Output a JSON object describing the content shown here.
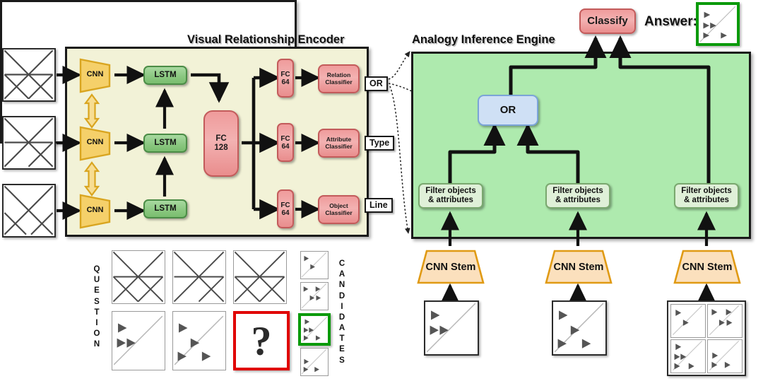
{
  "encoder": {
    "title": "Visual Relationship Encoder",
    "cnn_label": "CNN",
    "lstm_label": "LSTM",
    "fc128_label": "FC\n128",
    "fc128_line1": "FC",
    "fc128_line2": "128",
    "fc64_line1": "FC",
    "fc64_line2": "64",
    "classifiers": [
      {
        "line1": "Relation",
        "line2": "Classifier"
      },
      {
        "line1": "Attribute",
        "line2": "Classifier"
      },
      {
        "line1": "Object",
        "line2": "Classifier"
      }
    ],
    "branches": [
      {
        "fc": [
          "FC",
          "64"
        ],
        "classifier": [
          "Relation",
          "Classifier"
        ],
        "tag": "OR"
      },
      {
        "fc": [
          "FC",
          "64"
        ],
        "classifier": [
          "Attribute",
          "Classifier"
        ],
        "tag": "Type"
      },
      {
        "fc": [
          "FC",
          "64"
        ],
        "classifier": [
          "Object",
          "Classifier"
        ],
        "tag": "Line"
      }
    ],
    "input_rows": 3,
    "colors": {
      "panel_bg": "#f2f2d7",
      "cnn_fill": "#f5d06a",
      "cnn_stroke": "#d9a520",
      "lstm_fill": "#8cc882",
      "fc_fill": "#ef9b9b"
    }
  },
  "tags": {
    "or": "OR",
    "type": "Type",
    "line": "Line"
  },
  "engine": {
    "title": "Analogy Inference Engine",
    "or_node": "OR",
    "filter_line1": "Filter objects",
    "filter_line2": "& attributes",
    "filters": [
      {
        "line1": "Filter objects",
        "line2": "& attributes"
      },
      {
        "line1": "Filter objects",
        "line2": "& attributes"
      },
      {
        "line1": "Filter objects",
        "line2": "& attributes"
      }
    ],
    "cnn_stem_label": "CNN Stem",
    "cnn_stems": [
      "CNN Stem",
      "CNN Stem",
      "CNN Stem"
    ],
    "colors": {
      "panel_bg": "#aeeaae",
      "or_fill": "#cfe0f5",
      "filter_fill": "#dff0d8",
      "stem_fill": "#fbe0bd",
      "stem_stroke": "#e09a14"
    }
  },
  "classify": {
    "label": "Classify",
    "color": "#f3b2b2"
  },
  "answer": {
    "label": "Answer:",
    "highlight_color": "#0ad00a"
  },
  "question_panel": {
    "question_label": "QUESTION",
    "question_letters": [
      "Q",
      "U",
      "E",
      "S",
      "T",
      "I",
      "O",
      "N"
    ],
    "candidates_label": "CANDIDATES",
    "candidates_letters": [
      "C",
      "A",
      "N",
      "D",
      "I",
      "D",
      "A",
      "T",
      "E",
      "S"
    ],
    "missing_cell_symbol": "?",
    "missing_cell_border_color": "#e00000",
    "selected_candidate_index": 2,
    "selected_candidate_border_color": "#0a9a0a",
    "grid_rows": 2,
    "grid_cols": 3,
    "candidate_count": 4
  }
}
